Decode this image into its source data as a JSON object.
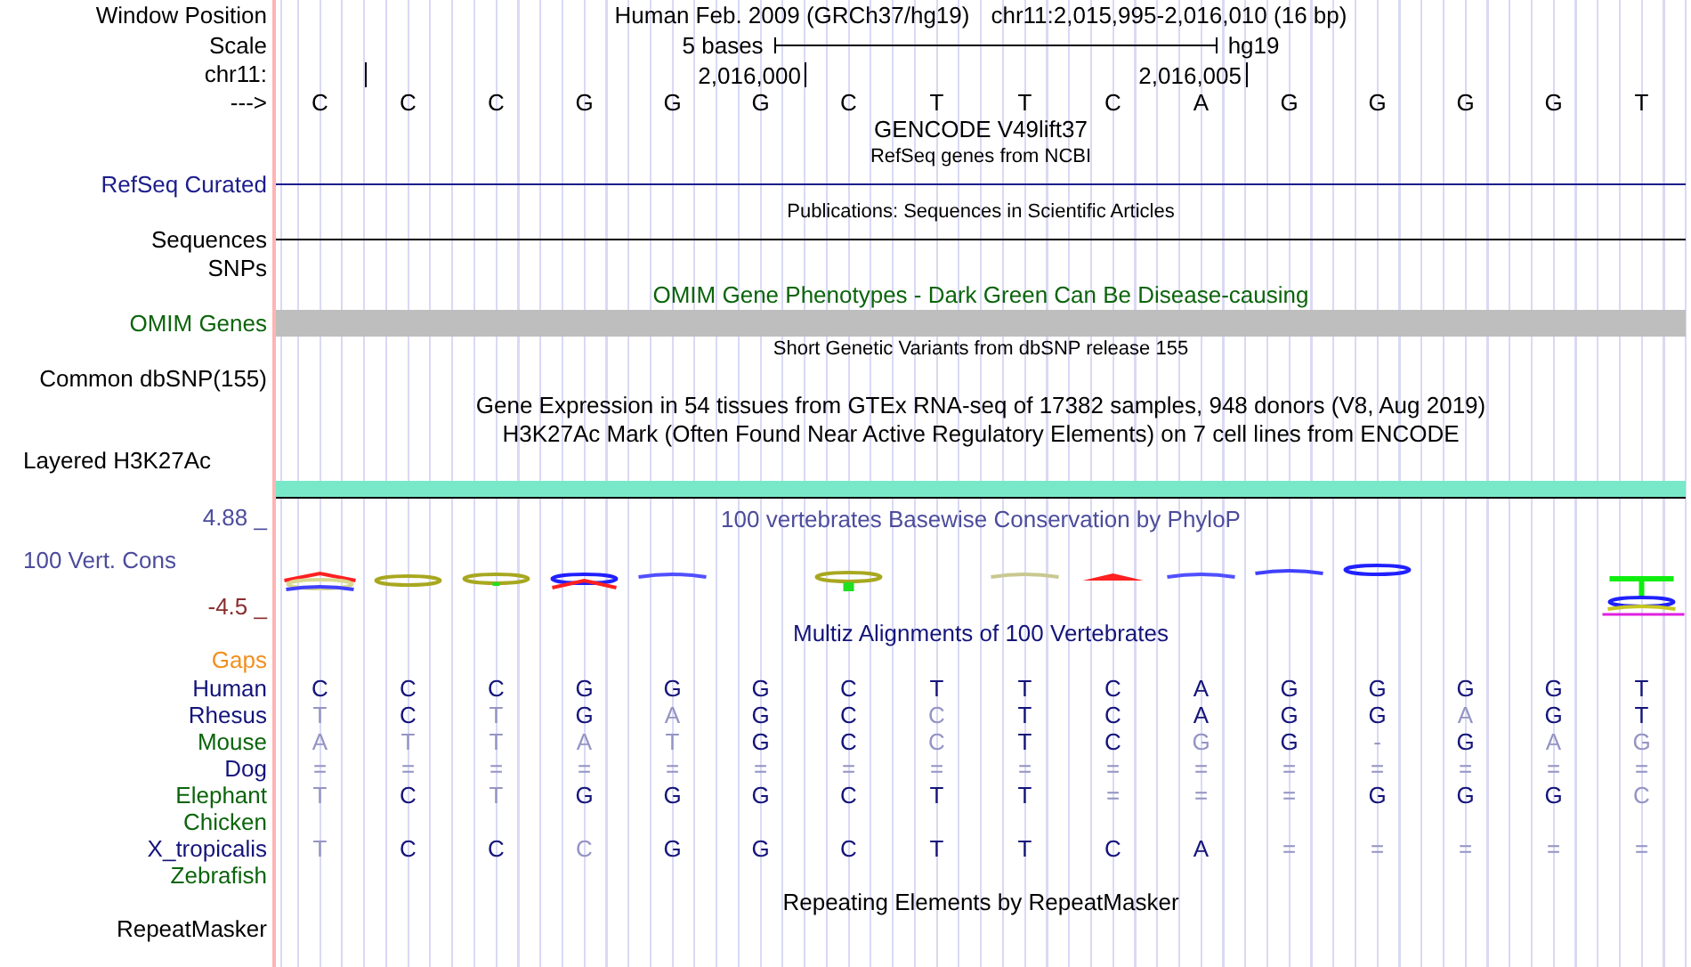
{
  "rows": [
    {
      "kind": "position",
      "label": "Window Position",
      "text": "Human Feb. 2009 (GRCh37/hg19)",
      "position": "chr11:2,015,995-2,016,010 (16 bp)"
    },
    {
      "kind": "scale",
      "label": "Scale",
      "text": "5 bases",
      "assembly": "hg19"
    },
    {
      "kind": "coords",
      "label": "chr11:",
      "tick_labels": [
        "2,016,000",
        "2,016,005"
      ]
    },
    {
      "kind": "bases",
      "label": "--->",
      "bases": [
        "C",
        "C",
        "C",
        "G",
        "G",
        "G",
        "C",
        "T",
        "T",
        "C",
        "A",
        "G",
        "G",
        "G",
        "G",
        "T"
      ]
    },
    {
      "kind": "title",
      "text": "GENCODE V49lift37",
      "color": "#000000"
    },
    {
      "kind": "caption",
      "text": "RefSeq genes from NCBI"
    },
    {
      "kind": "line",
      "label": "RefSeq Curated",
      "color": "#1c1c8c"
    },
    {
      "kind": "caption",
      "text": "Publications: Sequences in Scientific Articles"
    },
    {
      "kind": "line",
      "label": "Sequences",
      "color": "#000000"
    },
    {
      "kind": "label",
      "label": "SNPs",
      "color": "#000000"
    },
    {
      "kind": "title",
      "text": "OMIM Gene Phenotypes - Dark Green Can Be Disease-causing",
      "color": "#0b640b"
    },
    {
      "kind": "bar",
      "label": "OMIM Genes",
      "color": "#0b640b"
    },
    {
      "kind": "caption",
      "text": "Short Genetic Variants from dbSNP release 155"
    },
    {
      "kind": "label",
      "label": "Common dbSNP(155)",
      "color": "#000000"
    },
    {
      "kind": "title",
      "text": "Gene Expression in 54 tissues from GTEx RNA-seq of 17382 samples, 948 donors (V8, Aug 2019)",
      "color": "#000000"
    },
    {
      "kind": "title",
      "text": "H3K27Ac Mark (Often Found Near Active Regulatory Elements) on 7 cell lines from ENCODE",
      "color": "#000000"
    },
    {
      "kind": "composite",
      "label": "Layered H3K27Ac",
      "color": "#000000"
    },
    {
      "kind": "band",
      "color": "#78e8c8"
    },
    {
      "kind": "wiggle",
      "label": "100 Vert. Cons",
      "max": "4.88 _",
      "min": "-4.5 _",
      "title": "100 vertebrates Basewise Conservation by PhyloP",
      "color": "#4c4c9c"
    },
    {
      "kind": "title",
      "text": "Multiz Alignments of 100 Vertebrates",
      "color": "#14147a"
    },
    {
      "kind": "label",
      "label": "Gaps",
      "color": "#f0901e"
    },
    {
      "kind": "species",
      "label": "Human",
      "color": "#14147a",
      "bases": [
        {
          "base": "C",
          "faded": false
        },
        {
          "base": "C",
          "faded": false
        },
        {
          "base": "C",
          "faded": false
        },
        {
          "base": "G",
          "faded": false
        },
        {
          "base": "G",
          "faded": false
        },
        {
          "base": "G",
          "faded": false
        },
        {
          "base": "C",
          "faded": false
        },
        {
          "base": "T",
          "faded": false
        },
        {
          "base": "T",
          "faded": false
        },
        {
          "base": "C",
          "faded": false
        },
        {
          "base": "A",
          "faded": false
        },
        {
          "base": "G",
          "faded": false
        },
        {
          "base": "G",
          "faded": false
        },
        {
          "base": "G",
          "faded": false
        },
        {
          "base": "G",
          "faded": false
        },
        {
          "base": "T",
          "faded": false
        }
      ]
    },
    {
      "kind": "species",
      "label": "Rhesus",
      "color": "#14147a",
      "bases": [
        {
          "base": "T",
          "faded": true
        },
        {
          "base": "C",
          "faded": false
        },
        {
          "base": "T",
          "faded": true
        },
        {
          "base": "G",
          "faded": false
        },
        {
          "base": "A",
          "faded": true
        },
        {
          "base": "G",
          "faded": false
        },
        {
          "base": "C",
          "faded": false
        },
        {
          "base": "C",
          "faded": true
        },
        {
          "base": "T",
          "faded": false
        },
        {
          "base": "C",
          "faded": false
        },
        {
          "base": "A",
          "faded": false
        },
        {
          "base": "G",
          "faded": false
        },
        {
          "base": "G",
          "faded": false
        },
        {
          "base": "A",
          "faded": true
        },
        {
          "base": "G",
          "faded": false
        },
        {
          "base": "T",
          "faded": false
        }
      ]
    },
    {
      "kind": "species",
      "label": "Mouse",
      "color": "#0b640b",
      "bases": [
        {
          "base": "A",
          "faded": true
        },
        {
          "base": "T",
          "faded": true
        },
        {
          "base": "T",
          "faded": true
        },
        {
          "base": "A",
          "faded": true
        },
        {
          "base": "T",
          "faded": true
        },
        {
          "base": "G",
          "faded": false
        },
        {
          "base": "C",
          "faded": false
        },
        {
          "base": "C",
          "faded": true
        },
        {
          "base": "T",
          "faded": false
        },
        {
          "base": "C",
          "faded": false
        },
        {
          "base": "G",
          "faded": true
        },
        {
          "base": "G",
          "faded": false
        },
        {
          "base": "-",
          "faded": true
        },
        {
          "base": "G",
          "faded": false
        },
        {
          "base": "A",
          "faded": true
        },
        {
          "base": "G",
          "faded": true
        }
      ]
    },
    {
      "kind": "species",
      "label": "Dog",
      "color": "#14147a",
      "bases": [
        {
          "base": "=",
          "faded": true
        },
        {
          "base": "=",
          "faded": true
        },
        {
          "base": "=",
          "faded": true
        },
        {
          "base": "=",
          "faded": true
        },
        {
          "base": "=",
          "faded": true
        },
        {
          "base": "=",
          "faded": true
        },
        {
          "base": "=",
          "faded": true
        },
        {
          "base": "=",
          "faded": true
        },
        {
          "base": "=",
          "faded": true
        },
        {
          "base": "=",
          "faded": true
        },
        {
          "base": "=",
          "faded": true
        },
        {
          "base": "=",
          "faded": true
        },
        {
          "base": "=",
          "faded": true
        },
        {
          "base": "=",
          "faded": true
        },
        {
          "base": "=",
          "faded": true
        },
        {
          "base": "=",
          "faded": true
        }
      ]
    },
    {
      "kind": "species",
      "label": "Elephant",
      "color": "#0b640b",
      "bases": [
        {
          "base": "T",
          "faded": true
        },
        {
          "base": "C",
          "faded": false
        },
        {
          "base": "T",
          "faded": true
        },
        {
          "base": "G",
          "faded": false
        },
        {
          "base": "G",
          "faded": false
        },
        {
          "base": "G",
          "faded": false
        },
        {
          "base": "C",
          "faded": false
        },
        {
          "base": "T",
          "faded": false
        },
        {
          "base": "T",
          "faded": false
        },
        {
          "base": "=",
          "faded": true
        },
        {
          "base": "=",
          "faded": true
        },
        {
          "base": "=",
          "faded": true
        },
        {
          "base": "G",
          "faded": false
        },
        {
          "base": "G",
          "faded": false
        },
        {
          "base": "G",
          "faded": false
        },
        {
          "base": "C",
          "faded": true
        }
      ]
    },
    {
      "kind": "species",
      "label": "Chicken",
      "color": "#0b640b"
    },
    {
      "kind": "species",
      "label": "X_tropicalis",
      "color": "#14147a",
      "bases": [
        {
          "base": "T",
          "faded": true
        },
        {
          "base": "C",
          "faded": false
        },
        {
          "base": "C",
          "faded": false
        },
        {
          "base": "C",
          "faded": true
        },
        {
          "base": "G",
          "faded": false
        },
        {
          "base": "G",
          "faded": false
        },
        {
          "base": "C",
          "faded": false
        },
        {
          "base": "T",
          "faded": false
        },
        {
          "base": "T",
          "faded": false
        },
        {
          "base": "C",
          "faded": false
        },
        {
          "base": "A",
          "faded": false
        },
        {
          "base": "=",
          "faded": true
        },
        {
          "base": "=",
          "faded": true
        },
        {
          "base": "=",
          "faded": true
        },
        {
          "base": "=",
          "faded": true
        },
        {
          "base": "=",
          "faded": true
        }
      ]
    },
    {
      "kind": "species",
      "label": "Zebrafish",
      "color": "#0b640b"
    },
    {
      "kind": "title",
      "text": "Repeating Elements by RepeatMasker",
      "color": "#000000"
    },
    {
      "kind": "label",
      "label": "RepeatMasker",
      "color": "#000000"
    }
  ]
}
